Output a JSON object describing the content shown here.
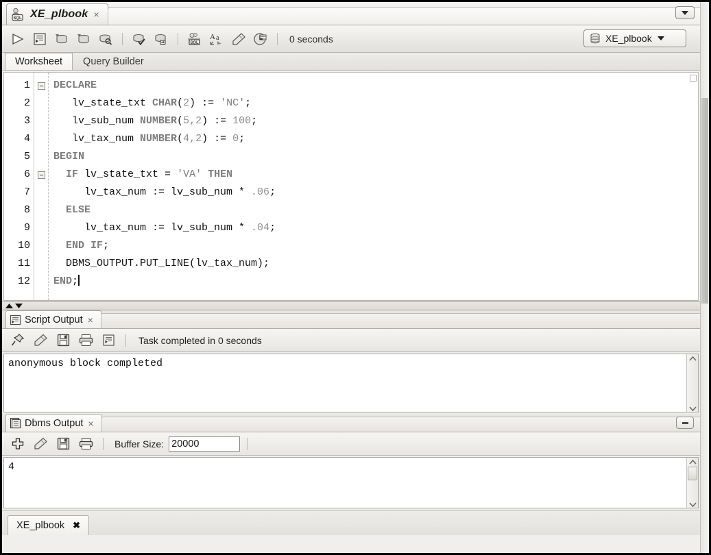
{
  "window": {
    "tab_title": "XE_plbook",
    "tab_close": "×"
  },
  "toolbar": {
    "icons": [
      {
        "name": "run-statement-icon",
        "label": "Run Statement"
      },
      {
        "name": "run-script-icon",
        "label": "Run Script"
      },
      {
        "name": "commit-icon",
        "label": "Commit"
      },
      {
        "name": "rollback-icon",
        "label": "Rollback"
      },
      {
        "name": "explain-plan-icon",
        "label": "Explain Plan"
      },
      {
        "name": "autotrace-icon",
        "label": "Autotrace"
      },
      {
        "name": "sql-history-db-icon",
        "label": "SQL History"
      },
      {
        "name": "sql-format-icon",
        "label": "Format SQL"
      },
      {
        "name": "completion-insight-icon",
        "label": "Completion Insight"
      },
      {
        "name": "clear-icon",
        "label": "Clear"
      },
      {
        "name": "recall-icon",
        "label": "Recall Statement"
      }
    ],
    "elapsed_time": "0 seconds",
    "connection_name": "XE_plbook"
  },
  "sub_tabs": [
    {
      "label": "Worksheet",
      "active": true
    },
    {
      "label": "Query Builder",
      "active": false
    }
  ],
  "editor": {
    "lines": [
      {
        "n": "1",
        "fold": true,
        "tokens": [
          {
            "t": "DECLARE",
            "c": "kw"
          }
        ]
      },
      {
        "n": "2",
        "fold": false,
        "tokens": [
          {
            "t": "   lv_state_txt ",
            "c": ""
          },
          {
            "t": "CHAR",
            "c": "kw"
          },
          {
            "t": "(",
            "c": ""
          },
          {
            "t": "2",
            "c": "num"
          },
          {
            "t": ") := ",
            "c": ""
          },
          {
            "t": "'NC'",
            "c": "str"
          },
          {
            "t": ";",
            "c": ""
          }
        ]
      },
      {
        "n": "3",
        "fold": false,
        "tokens": [
          {
            "t": "   lv_sub_num ",
            "c": ""
          },
          {
            "t": "NUMBER",
            "c": "kw"
          },
          {
            "t": "(",
            "c": ""
          },
          {
            "t": "5,2",
            "c": "num"
          },
          {
            "t": ") := ",
            "c": ""
          },
          {
            "t": "100",
            "c": "num"
          },
          {
            "t": ";",
            "c": ""
          }
        ]
      },
      {
        "n": "4",
        "fold": false,
        "tokens": [
          {
            "t": "   lv_tax_num ",
            "c": ""
          },
          {
            "t": "NUMBER",
            "c": "kw"
          },
          {
            "t": "(",
            "c": ""
          },
          {
            "t": "4,2",
            "c": "num"
          },
          {
            "t": ") := ",
            "c": ""
          },
          {
            "t": "0",
            "c": "num"
          },
          {
            "t": ";",
            "c": ""
          }
        ]
      },
      {
        "n": "5",
        "fold": false,
        "tokens": [
          {
            "t": "BEGIN",
            "c": "kw"
          }
        ]
      },
      {
        "n": "6",
        "fold": true,
        "tokens": [
          {
            "t": "  ",
            "c": ""
          },
          {
            "t": "IF",
            "c": "kw"
          },
          {
            "t": " lv_state_txt = ",
            "c": ""
          },
          {
            "t": "'VA'",
            "c": "str"
          },
          {
            "t": " ",
            "c": ""
          },
          {
            "t": "THEN",
            "c": "kw"
          }
        ]
      },
      {
        "n": "7",
        "fold": false,
        "tokens": [
          {
            "t": "     lv_tax_num := lv_sub_num * ",
            "c": ""
          },
          {
            "t": ".06",
            "c": "num"
          },
          {
            "t": ";",
            "c": ""
          }
        ]
      },
      {
        "n": "8",
        "fold": false,
        "tokens": [
          {
            "t": "  ",
            "c": ""
          },
          {
            "t": "ELSE",
            "c": "kw"
          }
        ]
      },
      {
        "n": "9",
        "fold": false,
        "tokens": [
          {
            "t": "     lv_tax_num := lv_sub_num * ",
            "c": ""
          },
          {
            "t": ".04",
            "c": "num"
          },
          {
            "t": ";",
            "c": ""
          }
        ]
      },
      {
        "n": "10",
        "fold": false,
        "tokens": [
          {
            "t": "  ",
            "c": ""
          },
          {
            "t": "END IF",
            "c": "kw"
          },
          {
            "t": ";",
            "c": ""
          }
        ]
      },
      {
        "n": "11",
        "fold": false,
        "tokens": [
          {
            "t": "  DBMS_OUTPUT.PUT_LINE(lv_tax_num);",
            "c": ""
          }
        ]
      },
      {
        "n": "12",
        "fold": false,
        "tokens": [
          {
            "t": "END",
            "c": "kw"
          },
          {
            "t": ";",
            "c": ""
          }
        ],
        "caret": true
      }
    ]
  },
  "script_output": {
    "tab_label": "Script Output",
    "tab_close": "×",
    "icons": [
      {
        "name": "pin-icon",
        "label": "Pin"
      },
      {
        "name": "clear-icon",
        "label": "Clear"
      },
      {
        "name": "save-icon",
        "label": "Save"
      },
      {
        "name": "print-icon",
        "label": "Print"
      },
      {
        "name": "script-icon",
        "label": "Script"
      }
    ],
    "status": "Task completed in 0 seconds",
    "content": "anonymous block completed"
  },
  "dbms_output": {
    "tab_label": "Dbms Output",
    "tab_close": "×",
    "icons": [
      {
        "name": "add-icon",
        "label": "Enable Dbms Output"
      },
      {
        "name": "clear-icon",
        "label": "Clear"
      },
      {
        "name": "save-icon",
        "label": "Save"
      },
      {
        "name": "print-icon",
        "label": "Print"
      }
    ],
    "buffer_size_label": "Buffer Size:",
    "buffer_size_value": "20000",
    "content": "4"
  },
  "bottom_tabs": [
    {
      "label": "XE_plbook",
      "close": "✖"
    }
  ],
  "colors": {
    "keyword": "#7d7d7d",
    "number": "#8e8e8e",
    "text": "#111111",
    "chrome": "#efedea"
  }
}
